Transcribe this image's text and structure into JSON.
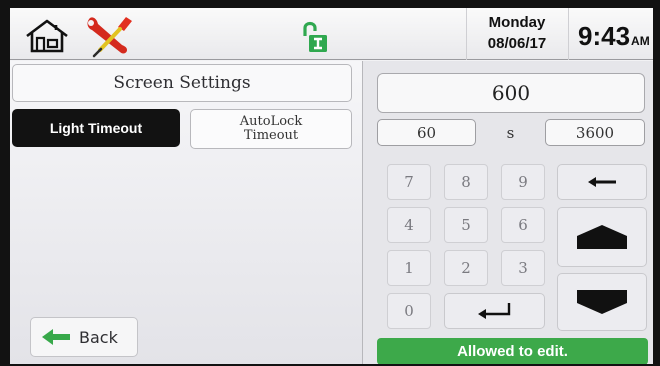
{
  "header": {
    "day": "Monday",
    "date": "08/06/17",
    "time": "9:43",
    "ampm": "AM",
    "icons": [
      "home-icon",
      "tools-icon",
      "unlocked-lock-icon"
    ]
  },
  "left": {
    "title": "Screen Settings",
    "tabs": {
      "light_timeout": "Light Timeout",
      "autolock_line1": "AutoLock",
      "autolock_line2": "Timeout"
    },
    "back_label": "Back"
  },
  "editor": {
    "value": "600",
    "min": "60",
    "unit": "s",
    "max": "3600",
    "keys": [
      "7",
      "8",
      "9",
      "4",
      "5",
      "6",
      "1",
      "2",
      "3",
      "0"
    ],
    "status": "Allowed to edit."
  },
  "colors": {
    "status_green": "#3da94a",
    "lock_green": "#2fa84f",
    "tools_red": "#d42a1e",
    "tools_yellow": "#e2c320",
    "active_tab": "#121212"
  }
}
